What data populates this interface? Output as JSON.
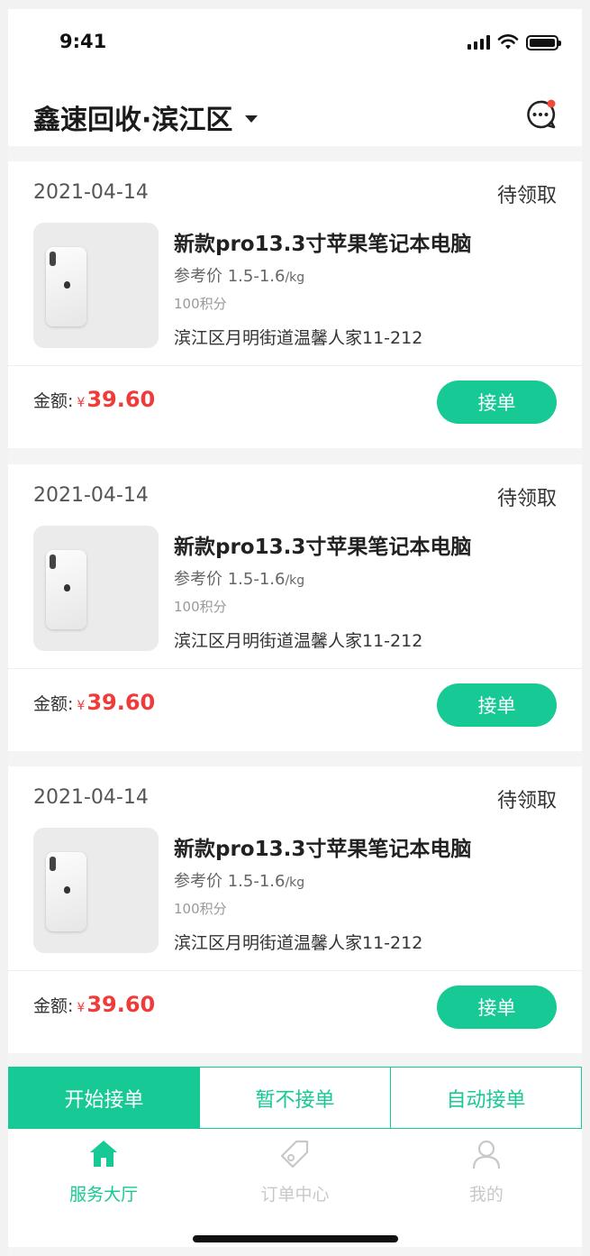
{
  "status_bar": {
    "time": "9:41"
  },
  "header": {
    "title": "鑫速回收·滨江区"
  },
  "orders": [
    {
      "date": "2021-04-14",
      "status": "待领取",
      "name": "新款pro13.3寸苹果笔记本电脑",
      "price_label": "参考价 1.5-1.6",
      "price_unit": "/kg",
      "points": "100积分",
      "address": "滨江区月明街道温馨人家11-212",
      "amount_label": "金额:",
      "currency": "¥",
      "amount": "39.60",
      "action": "接单"
    },
    {
      "date": "2021-04-14",
      "status": "待领取",
      "name": "新款pro13.3寸苹果笔记本电脑",
      "price_label": "参考价 1.5-1.6",
      "price_unit": "/kg",
      "points": "100积分",
      "address": "滨江区月明街道温馨人家11-212",
      "amount_label": "金额:",
      "currency": "¥",
      "amount": "39.60",
      "action": "接单"
    },
    {
      "date": "2021-04-14",
      "status": "待领取",
      "name": "新款pro13.3寸苹果笔记本电脑",
      "price_label": "参考价 1.5-1.6",
      "price_unit": "/kg",
      "points": "100积分",
      "address": "滨江区月明街道温馨人家11-212",
      "amount_label": "金额:",
      "currency": "¥",
      "amount": "39.60",
      "action": "接单"
    }
  ],
  "mode_bar": {
    "start": "开始接单",
    "pause": "暂不接单",
    "auto": "自动接单"
  },
  "tabbar": {
    "items": [
      {
        "label": "服务大厅",
        "icon": "home-icon"
      },
      {
        "label": "订单中心",
        "icon": "tag-icon"
      },
      {
        "label": "我的",
        "icon": "user-icon"
      }
    ]
  },
  "colors": {
    "accent": "#17c994",
    "price": "#f03b3b",
    "badge": "#f04a3a"
  }
}
